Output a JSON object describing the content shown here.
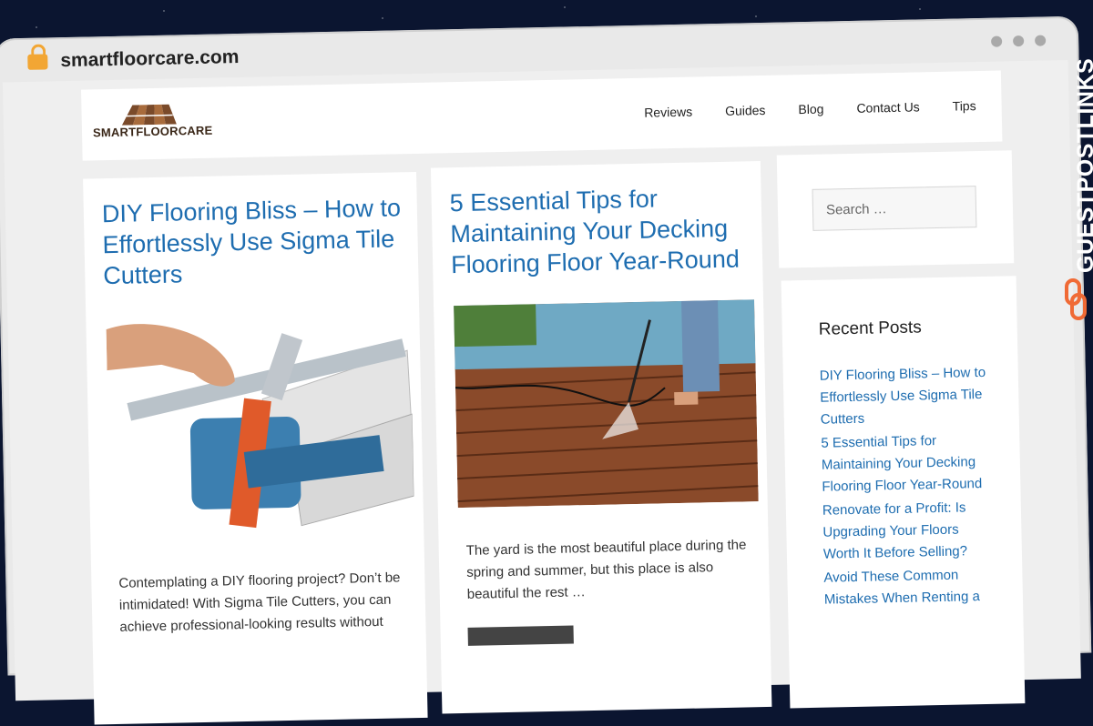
{
  "browser": {
    "url": "smartfloorcare.com"
  },
  "site": {
    "logo_text": "SMARTFLOORCARE"
  },
  "nav": {
    "items": [
      "Reviews",
      "Guides",
      "Blog",
      "Contact Us",
      "Tips"
    ]
  },
  "posts": [
    {
      "title": "DIY Flooring Bliss – How to Effortlessly Use Sigma Tile Cutters",
      "excerpt": "Contemplating a DIY flooring project? Don’t be intimidated! With Sigma Tile Cutters, you can achieve professional-looking results without"
    },
    {
      "title": "5 Essential Tips for Maintaining Your Decking Flooring Floor Year-Round",
      "excerpt": "The yard is the most beautiful place during the spring and summer, but this place is also beautiful the rest …"
    }
  ],
  "sidebar": {
    "search_placeholder": "Search …",
    "recent_title": "Recent Posts",
    "recent_posts": [
      "DIY Flooring Bliss – How to Effortlessly Use Sigma Tile Cutters",
      "5 Essential Tips for Maintaining Your Decking Flooring Floor Year-Round",
      "Renovate for a Profit: Is Upgrading Your Floors Worth It Before Selling?",
      "Avoid These Common Mistakes When Renting a"
    ]
  },
  "brand_watermark": "GUESTPOSTLINKS",
  "colors": {
    "link": "#1e6db0",
    "lock": "#f2a634",
    "brand_orange": "#f06a35"
  }
}
